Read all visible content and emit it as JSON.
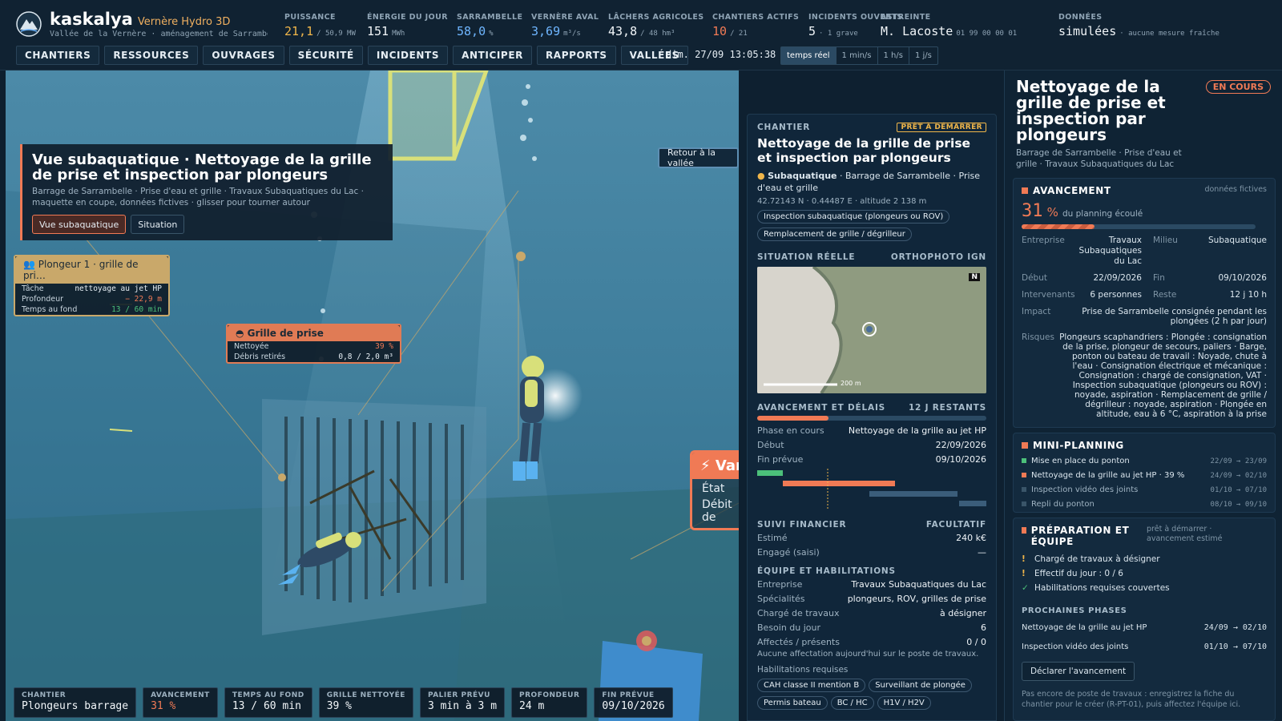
{
  "app": {
    "name": "kaskalya",
    "product": "Vernère Hydro 3D",
    "subtitle": "Vallée de la Vernère · aménagement de Sarrambelle…"
  },
  "kpis": [
    {
      "label": "PUISSANCE",
      "value": "21,1",
      "unit": "/ 50,9 MW",
      "color": "or"
    },
    {
      "label": "ÉNERGIE DU JOUR",
      "value": "151",
      "unit": "MWh",
      "color": "wh"
    },
    {
      "label": "SARRAMBELLE",
      "value": "58,0",
      "unit": "%",
      "color": "bl"
    },
    {
      "label": "VERNÈRE AVAL",
      "value": "3,69",
      "unit": "m³/s",
      "color": "bl"
    },
    {
      "label": "LÂCHERS AGRICOLES",
      "value": "43,8",
      "unit": "/ 48 hm³",
      "color": "wh"
    },
    {
      "label": "CHANTIERS ACTIFS",
      "value": "10",
      "unit": "/ 21",
      "color": "red"
    },
    {
      "label": "INCIDENTS OUVERTS",
      "value": "5",
      "unit": "· 1 grave",
      "color": "wh"
    },
    {
      "label": "ASTREINTE",
      "value": "M. Lacoste",
      "unit": "01 99 00 00 01",
      "color": "wh"
    },
    {
      "label": "DONNÉES",
      "value": "simulées",
      "unit": "· aucune mesure fraîche",
      "color": "wh"
    }
  ],
  "nav": [
    "CHANTIERS",
    "RESSOURCES",
    "OUVRAGES",
    "SÉCURITÉ",
    "INCIDENTS",
    "ANTICIPER",
    "RAPPORTS",
    "VALLÉES"
  ],
  "clock": "dim. 27/09 13:05:38",
  "time_modes": [
    "temps réel",
    "1 min/s",
    "1 h/s",
    "1 j/s"
  ],
  "scene": {
    "title": "Vue subaquatique · Nettoyage de la grille de prise et inspection par plongeurs",
    "subtitle": "Barrage de Sarrambelle · Prise d'eau et grille · Travaux Subaquatiques du Lac · maquette en coupe, données fictives · glisser pour tourner autour",
    "btn_under": "Vue subaquatique",
    "btn_situation": "Situation",
    "btn_back": "Retour à la vallée",
    "diver_tag": {
      "title": "Plongeur 1 · grille de pri…",
      "rows": [
        {
          "k": "Tâche",
          "v": "nettoyage au jet HP"
        },
        {
          "k": "Profondeur",
          "v": "− 22,9 m"
        },
        {
          "k": "Temps au fond",
          "v": "13 / 60 min"
        }
      ]
    },
    "grille_tag": {
      "title": "Grille de prise",
      "rows": [
        {
          "k": "Nettoyée",
          "v": "39 %"
        },
        {
          "k": "Débris retirés",
          "v": "0,8 / 2,0 m³"
        }
      ]
    },
    "vanne_tag": {
      "title": "Var",
      "r1": "État",
      "r2": "Débit de"
    }
  },
  "bottom": [
    {
      "l": "CHANTIER",
      "v": "Plongeurs barrage",
      "c": "wh"
    },
    {
      "l": "AVANCEMENT",
      "v": "31 %",
      "c": "red"
    },
    {
      "l": "TEMPS AU FOND",
      "v": "13 / 60 min",
      "c": "wh"
    },
    {
      "l": "GRILLE NETTOYÉE",
      "v": "39 %",
      "c": "wh"
    },
    {
      "l": "PALIER PRÉVU",
      "v": "3 min à 3 m",
      "c": "wh"
    },
    {
      "l": "PROFONDEUR",
      "v": "24 m",
      "c": "wh"
    },
    {
      "l": "FIN PRÉVUE",
      "v": "09/10/2026",
      "c": "wh"
    }
  ],
  "card": {
    "label": "CHANTIER",
    "badge": "PRÊT À DÉMARRER",
    "title": "Nettoyage de la grille de prise et inspection par plongeurs",
    "env": "Subaquatique",
    "loc": "· Barrage de Sarrambelle · Prise d'eau et grille",
    "coord": "42.72143 N · 0.44487 E · altitude 2 138 m",
    "pills": [
      "Inspection subaquatique (plongeurs ou ROV)",
      "Remplacement de grille / dégrilleur"
    ],
    "map_label": "SITUATION RÉELLE",
    "map_src": "ORTHOPHOTO IGN",
    "map_scale": "200 m",
    "map_north": "N",
    "progress_label": "AVANCEMENT ET DÉLAIS",
    "progress_rest": "12 J RESTANTS",
    "progress": 0.31,
    "phase": [
      {
        "k": "Phase en cours",
        "v": "Nettoyage de la grille au jet HP"
      },
      {
        "k": "Début",
        "v": "22/09/2026"
      },
      {
        "k": "Fin prévue",
        "v": "09/10/2026"
      }
    ],
    "fin_label": "SUIVI FINANCIER",
    "fin_opt": "FACULTATIF",
    "fin": [
      {
        "k": "Estimé",
        "v": "240 k€"
      },
      {
        "k": "Engagé (saisi)",
        "v": "—"
      }
    ],
    "team_label": "ÉQUIPE ET HABILITATIONS",
    "team": [
      {
        "k": "Entreprise",
        "v": "Travaux Subaquatiques du Lac"
      },
      {
        "k": "Spécialités",
        "v": "plongeurs, ROV, grilles de prise"
      },
      {
        "k": "Chargé de travaux",
        "v": "à désigner"
      },
      {
        "k": "Besoin du jour",
        "v": "6"
      },
      {
        "k": "Affectés / présents",
        "v": "0 / 0"
      }
    ],
    "no_assign": "Aucune affectation aujourd'hui sur le poste de travaux.",
    "hab_label": "Habilitations requises",
    "habs": [
      "CAH classe II mention B",
      "Surveillant de plongée",
      "Permis bateau",
      "BC / HC",
      "H1V / H2V"
    ]
  },
  "right": {
    "title": "Nettoyage de la grille de prise et inspection par plongeurs",
    "badge": "EN COURS",
    "sub": "Barrage de Sarrambelle · Prise d'eau et grille · Travaux Subaquatiques du Lac",
    "av_label": "AVANCEMENT",
    "av_note": "données fictives",
    "pct": "31",
    "pct_unit": "%",
    "pct_text": "du planning écoulé",
    "progress": 0.31,
    "facts": [
      {
        "k": "Entreprise",
        "v": "Travaux Subaquatiques du Lac",
        "k2": "Milieu",
        "v2": "Subaquatique"
      },
      {
        "k": "Début",
        "v": "22/09/2026",
        "k2": "Fin",
        "v2": "09/10/2026"
      },
      {
        "k": "Intervenants",
        "v": "6 personnes",
        "k2": "Reste",
        "v2": "12 j 10 h"
      }
    ],
    "impact_k": "Impact",
    "impact": "Prise de Sarrambelle consignée pendant les plongées (2 h par jour)",
    "risk_k": "Risques",
    "risks": "Plongeurs scaphandriers : Plongée : consignation de la prise, plongeur de secours, paliers · Barge, ponton ou bateau de travail : Noyade, chute à l'eau · Consignation électrique et mécanique : Consignation : chargé de consignation, VAT · Inspection subaquatique (plongeurs ou ROV) : noyade, aspiration · Remplacement de grille / dégrilleur : noyade, aspiration · Plongée en altitude, eau à 6 °C, aspiration à la prise",
    "mp_label": "MINI-PLANNING",
    "mp": [
      {
        "t": "Mise en place du ponton",
        "d": "22/09 → 23/09",
        "c": "#4cc07a",
        "dim": false
      },
      {
        "t": "Nettoyage de la grille au jet HP · 39 %",
        "d": "24/09 → 02/10",
        "c": "#f07a55",
        "dim": false
      },
      {
        "t": "Inspection vidéo des joints",
        "d": "01/10 → 07/10",
        "c": "#3a5569",
        "dim": true
      },
      {
        "t": "Repli du ponton",
        "d": "08/10 → 09/10",
        "c": "#3a5569",
        "dim": true
      }
    ],
    "prep_label": "PRÉPARATION ET ÉQUIPE",
    "prep_note": "prêt à démarrer · avancement estimé",
    "prep": [
      {
        "i": "!",
        "t": "Chargé de travaux à désigner",
        "c": "#f0b64a"
      },
      {
        "i": "!",
        "t": "Effectif du jour : 0 / 6",
        "c": "#f0b64a"
      },
      {
        "i": "✓",
        "t": "Habilitations requises couvertes",
        "c": "#4cc07a"
      }
    ],
    "next_label": "PROCHAINES PHASES",
    "next": [
      {
        "t": "Nettoyage de la grille au jet HP",
        "d": "24/09 → 02/10"
      },
      {
        "t": "Inspection vidéo des joints",
        "d": "01/10 → 07/10"
      }
    ],
    "declare": "Déclarer l'avancement",
    "note": "Pas encore de poste de travaux : enregistrez la fiche du chantier pour le créer (R-PT-01), puis affectez l'équipe ici."
  }
}
